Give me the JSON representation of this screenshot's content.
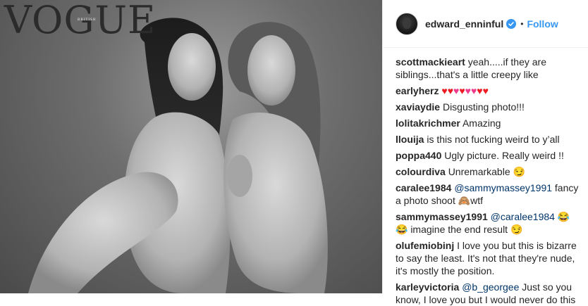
{
  "photo": {
    "masthead": "VOGUE",
    "masthead_sub": "BRITISH"
  },
  "header": {
    "username": "edward_enninful",
    "separator": "•",
    "follow_label": "Follow"
  },
  "comments": [
    {
      "user": "scottmackieart",
      "text": "yeah.....if they are siblings...that's a little creepy like"
    },
    {
      "user": "earlyherz",
      "text": ""
    },
    {
      "user": "xaviaydie",
      "text": "Disgusting photo!!!"
    },
    {
      "user": "lolitakrichmer",
      "text": "Amazing"
    },
    {
      "user": "llouija",
      "text": "is this not fucking weird to y’all"
    },
    {
      "user": "poppa440",
      "text": "Ugly picture. Really weird !!"
    },
    {
      "user": "colourdiva",
      "text": "Unremarkable 😏"
    },
    {
      "user": "caralee1984",
      "mention": "@sammymassey1991",
      "text": "fancy a photo shoot 🙈wtf"
    },
    {
      "user": "sammymassey1991",
      "mention": "@caralee1984",
      "text": "😂😂 imagine the end result 😏"
    },
    {
      "user": "olufemiobinj",
      "text": "I love you but this is bizarre to say the least. It's not that they're nude, it's mostly the position."
    },
    {
      "user": "karleyvictoria",
      "mention": "@b_georgee",
      "text": "Just so you know, I love you but I would never do this"
    }
  ],
  "hearts": [
    "red",
    "red",
    "pink",
    "red",
    "pink",
    "pink",
    "red",
    "red"
  ],
  "colors": {
    "follow": "#3897f0",
    "verified": "#3897f0",
    "mention": "#003569",
    "heart_red": "#ed1c24",
    "heart_pink": "#ee3b8c"
  },
  "icons": {
    "verified": "verified-badge-icon",
    "heart": "heart-emoji"
  }
}
